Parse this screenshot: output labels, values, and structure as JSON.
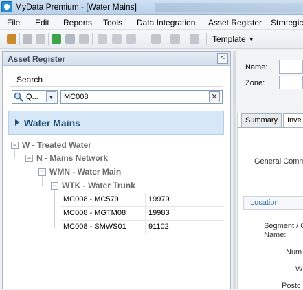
{
  "window": {
    "title": "MyData Premium - [Water Mains]"
  },
  "menu": {
    "items": [
      "File",
      "Edit",
      "Reports",
      "Tools",
      "Data Integration",
      "Asset Register",
      "Strategic"
    ]
  },
  "toolbar": {
    "template_label": "Template"
  },
  "asset_register": {
    "title": "Asset Register",
    "collapse_glyph": "<",
    "search": {
      "label": "Search",
      "type_value": "Q...",
      "query": "MC008",
      "clear_glyph": "✕"
    },
    "category": "Water Mains",
    "tree": [
      {
        "toggle": "−",
        "label": "W - Treated Water"
      },
      {
        "toggle": "−",
        "label": "N - Mains Network"
      },
      {
        "toggle": "−",
        "label": "WMN - Water Main"
      },
      {
        "toggle": "−",
        "label": "WTK - Water Trunk"
      }
    ],
    "results": [
      {
        "id": "MC008 - MC579",
        "value": "19979"
      },
      {
        "id": "MC008 - MGTM08",
        "value": "19983"
      },
      {
        "id": "MC008 - SMWS01",
        "value": "91102"
      }
    ]
  },
  "details": {
    "name_label": "Name:",
    "zone_label": "Zone:",
    "tabs": [
      "Summary",
      "Inve"
    ],
    "general_comments": "General Comme",
    "location_section": "Location",
    "segment_label_1": "Segment / G",
    "segment_label_2": "Name:",
    "num_label": "Num",
    "w_label": "W",
    "postc_label": "Postc"
  }
}
